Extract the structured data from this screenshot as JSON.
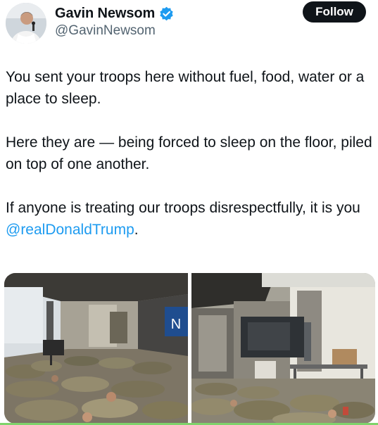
{
  "author": {
    "display_name": "Gavin Newsom",
    "handle": "@GavinNewsom",
    "verified": true,
    "verified_color": "#1d9bf0",
    "avatar_icon": "profile-photo"
  },
  "follow_button": {
    "label": "Follow"
  },
  "tweet": {
    "paragraph_1": "You sent your troops here without fuel, food, water or a place to sleep.",
    "paragraph_2": "Here they are — being forced to sleep on the floor, piled on top of one another.",
    "paragraph_3_text": "If anyone is treating our troops disrespectfully, it is you ",
    "paragraph_3_mention": "@realDonaldTrump",
    "paragraph_3_end": ".",
    "mention_color": "#1d9bf0"
  },
  "media": {
    "photos": [
      {
        "icon": "photo-troops-sleeping-hallway",
        "sign_letter": "N"
      },
      {
        "icon": "photo-troops-sleeping-warehouse"
      }
    ]
  }
}
